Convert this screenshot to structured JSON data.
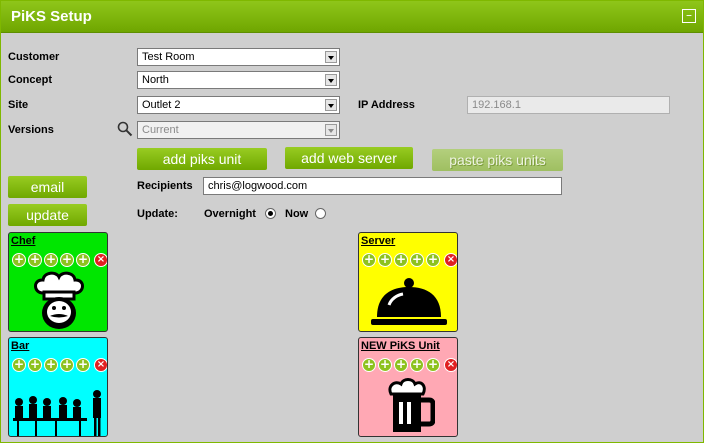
{
  "window": {
    "title": "PiKS Setup",
    "minimize_glyph": "–"
  },
  "form": {
    "customer": {
      "label": "Customer",
      "value": "Test Room"
    },
    "concept": {
      "label": "Concept",
      "value": "North"
    },
    "site": {
      "label": "Site",
      "value": "Outlet 2"
    },
    "ip": {
      "label": "IP Address",
      "value": "192.168.1"
    },
    "versions": {
      "label": "Versions",
      "value": "Current"
    }
  },
  "actions": {
    "add_piks_unit": "add piks unit",
    "add_web_server": "add web server",
    "paste_piks_units": "paste piks units",
    "email": "email",
    "update": "update"
  },
  "recipients": {
    "label": "Recipients",
    "value": "chris@logwood.com"
  },
  "update_mode": {
    "label": "Update:",
    "overnight": "Overnight",
    "now": "Now",
    "selected": "Overnight"
  },
  "tiles": [
    {
      "name": "Chef",
      "color": "#00e600",
      "icon": "chef-icon"
    },
    {
      "name": "Server",
      "color": "#ffff00",
      "icon": "cloche-icon"
    },
    {
      "name": "Bar",
      "color": "#00ffff",
      "icon": "diners-icon"
    },
    {
      "name": "NEW PiKS Unit",
      "color": "#ffa8b4",
      "icon": "beer-mug-icon"
    }
  ],
  "tile_tools": {
    "plus": "+",
    "delete": "×"
  },
  "colors": {
    "accent": "#7fb800",
    "panel_bg": "#cfcfcf"
  }
}
